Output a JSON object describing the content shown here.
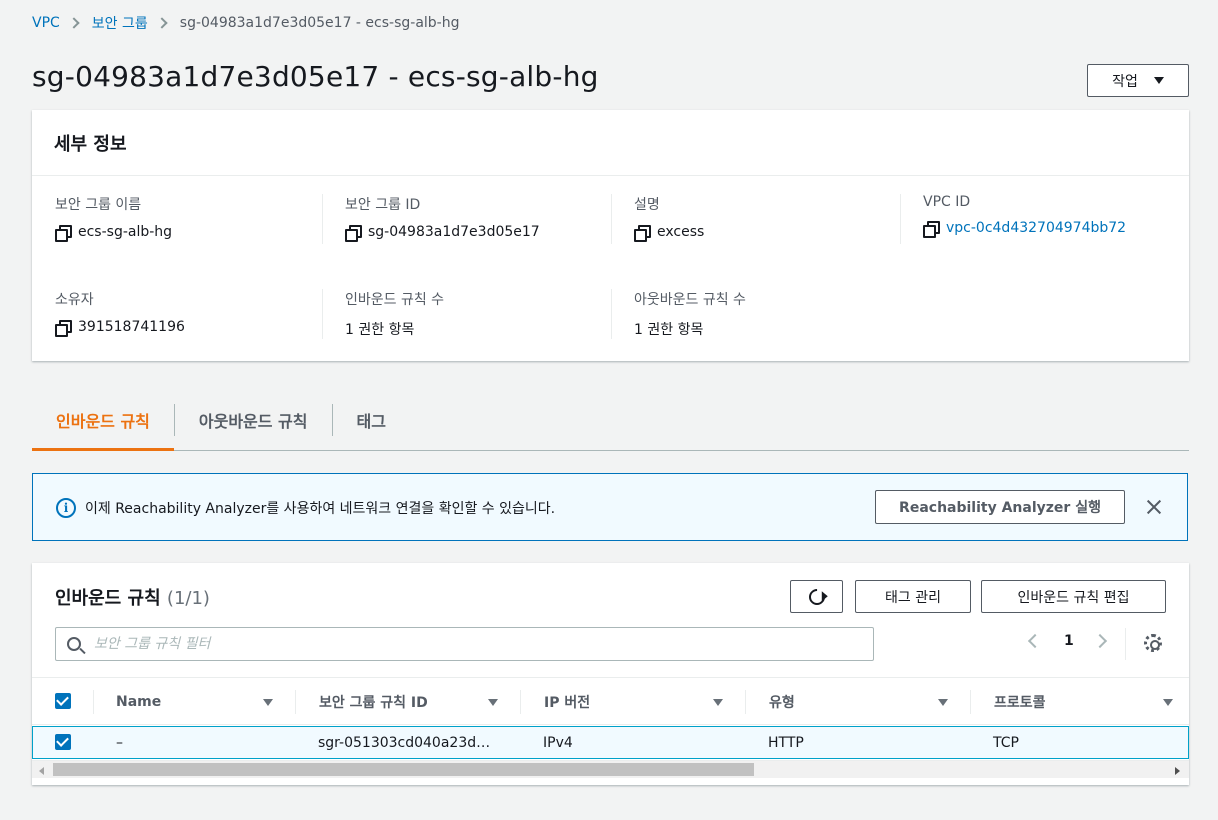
{
  "breadcrumb": [
    "VPC",
    "보안 그룹",
    "sg-04983a1d7e3d05e17 - ecs-sg-alb-hg"
  ],
  "page_title": "sg-04983a1d7e3d05e17 - ecs-sg-alb-hg",
  "actions_label": "작업",
  "details": {
    "title": "세부 정보",
    "fields": [
      {
        "label": "보안 그룹 이름",
        "value": "ecs-sg-alb-hg"
      },
      {
        "label": "보안 그룹 ID",
        "value": "sg-04983a1d7e3d05e17"
      },
      {
        "label": "설명",
        "value": "excess"
      },
      {
        "label": "VPC ID",
        "value": "vpc-0c4d432704974bb72"
      },
      {
        "label": "소유자",
        "value": "391518741196"
      },
      {
        "label": "인바운드 규칙 수",
        "value": "1 권한 항목"
      },
      {
        "label": "아웃바운드 규칙 수",
        "value": "1 권한 항목"
      }
    ]
  },
  "tabs": [
    "인바운드 규칙",
    "아웃바운드 규칙",
    "태그"
  ],
  "banner": {
    "text": "이제 Reachability Analyzer를 사용하여 네트워크 연결을 확인할 수 있습니다.",
    "button": "Reachability Analyzer 실행"
  },
  "rules": {
    "title": "인바운드 규칙",
    "count": "(1/1)",
    "tag_button": "태그 관리",
    "edit_button": "인바운드 규칙 편집",
    "search_placeholder": "보안 그룹 규칙 필터",
    "page": "1",
    "columns": [
      "Name",
      "보안 그룹 규칙 ID",
      "IP 버전",
      "유형",
      "프로토콜"
    ],
    "rows": [
      {
        "name": "–",
        "rule_id": "sgr-051303cd040a23d…",
        "ip_version": "IPv4",
        "type": "HTTP",
        "protocol": "TCP"
      }
    ]
  },
  "colors": {
    "link": "#0073bb",
    "active_tab": "#ec7211",
    "banner_bg": "#f1faff"
  }
}
